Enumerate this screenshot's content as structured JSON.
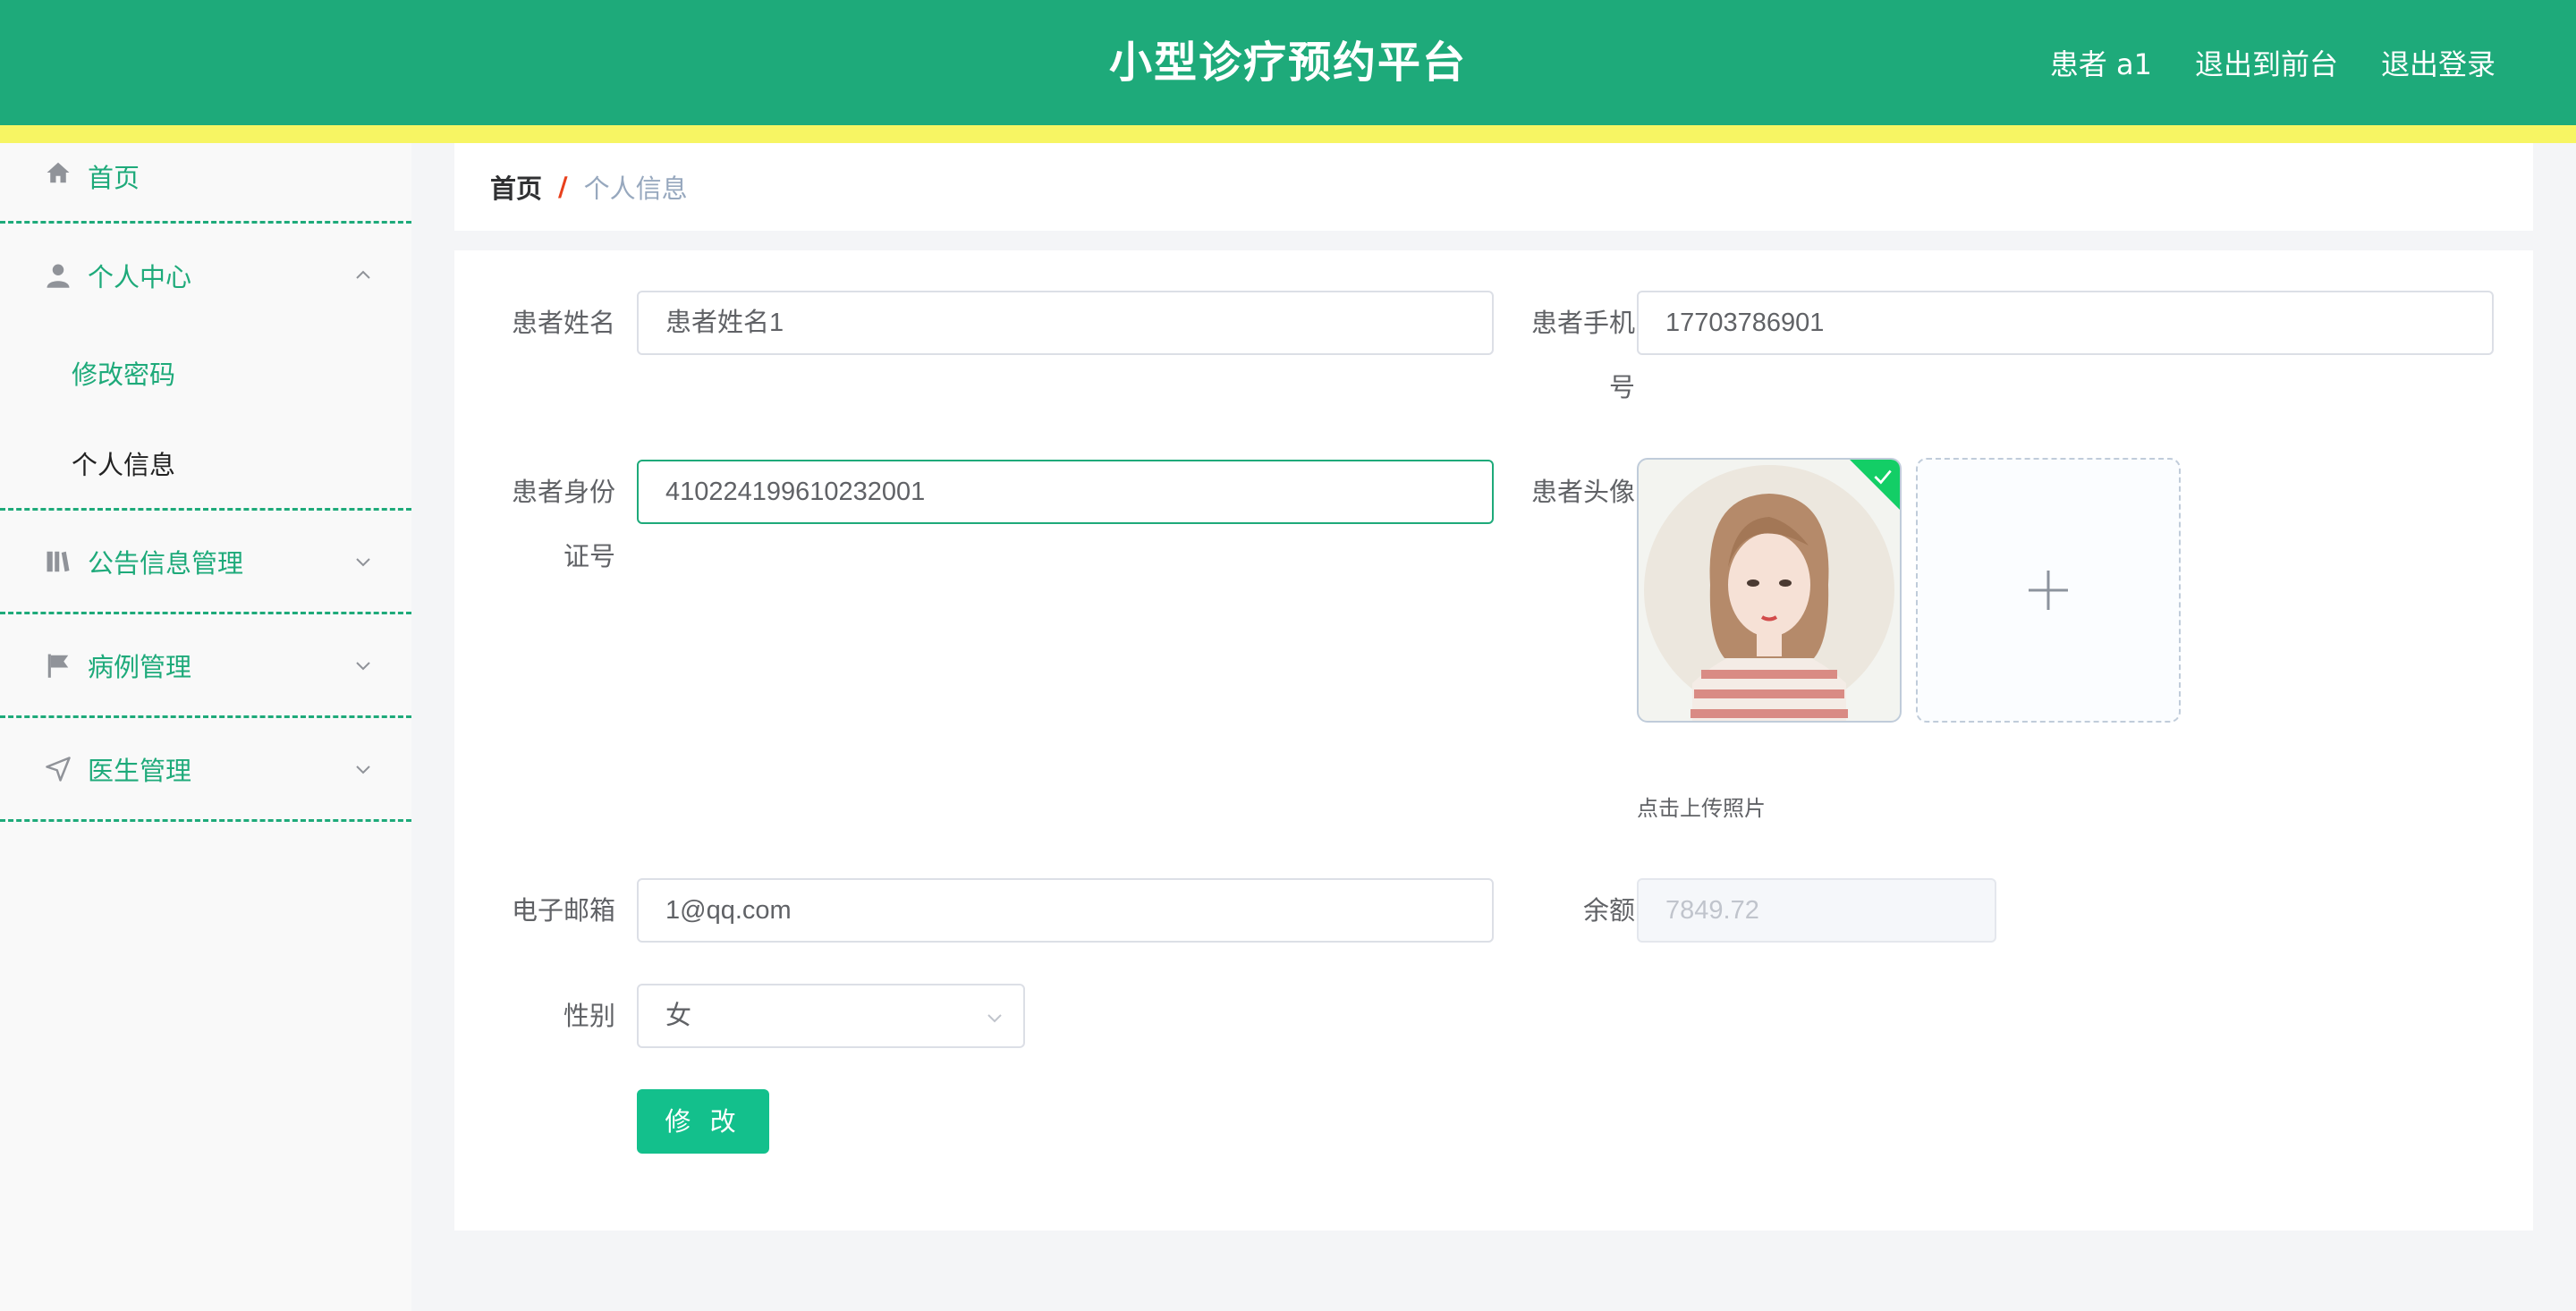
{
  "header": {
    "title": "小型诊疗预约平台",
    "user": "患者 a1",
    "back_to_front": "退出到前台",
    "logout": "退出登录"
  },
  "sidebar": {
    "home": "首页",
    "personal_center": "个人中心",
    "change_password": "修改密码",
    "personal_info": "个人信息",
    "notice_mgmt": "公告信息管理",
    "case_mgmt": "病例管理",
    "doctor_mgmt": "医生管理"
  },
  "breadcrumb": {
    "home": "首页",
    "separator": "/",
    "current": "个人信息"
  },
  "form": {
    "name_label": "患者姓名",
    "name_value": "患者姓名1",
    "phone_label_1": "患者手机",
    "phone_label_2": "号",
    "phone_value": "17703786901",
    "id_label_1": "患者身份",
    "id_label_2": "证号",
    "id_value": "410224199610232001",
    "avatar_label": "患者头像",
    "upload_tip": "点击上传照片",
    "email_label": "电子邮箱",
    "email_value": "1@qq.com",
    "balance_label": "余额",
    "balance_value": "7849.72",
    "gender_label": "性别",
    "gender_value": "女",
    "submit_label": "修 改"
  },
  "colors": {
    "primary": "#1eaa7a",
    "strip": "#f7f563",
    "button": "#13c08c"
  }
}
